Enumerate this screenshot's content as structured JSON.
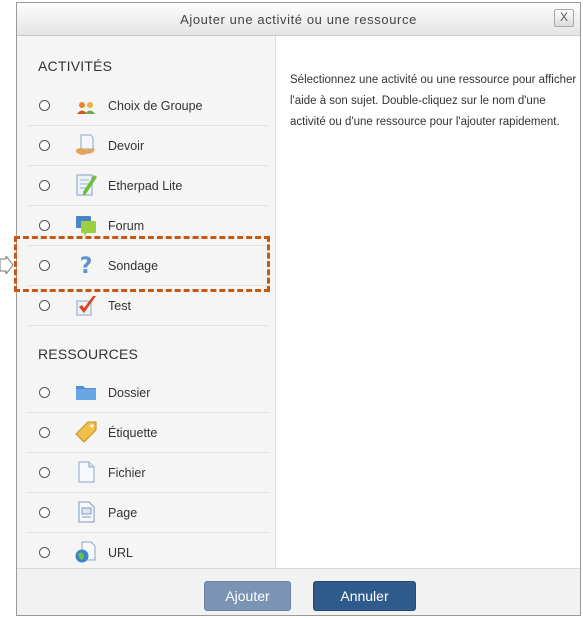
{
  "dialog": {
    "title": "Ajouter une activité ou une ressource",
    "close_label": "X"
  },
  "sections": {
    "activities": "ACTIVITÉS",
    "resources": "RESSOURCES"
  },
  "activities": [
    {
      "label": "Choix de Groupe",
      "icon": "group-choice-icon"
    },
    {
      "label": "Devoir",
      "icon": "assignment-icon"
    },
    {
      "label": "Etherpad Lite",
      "icon": "etherpad-icon"
    },
    {
      "label": "Forum",
      "icon": "forum-icon"
    },
    {
      "label": "Sondage",
      "icon": "question-icon"
    },
    {
      "label": "Test",
      "icon": "checkmark-icon"
    }
  ],
  "resources": [
    {
      "label": "Dossier",
      "icon": "folder-icon"
    },
    {
      "label": "Étiquette",
      "icon": "tag-icon"
    },
    {
      "label": "Fichier",
      "icon": "file-icon"
    },
    {
      "label": "Page",
      "icon": "page-icon"
    },
    {
      "label": "URL",
      "icon": "globe-link-icon"
    }
  ],
  "help_text": "Sélectionnez une activité ou une ressource pour afficher l'aide à son sujet. Double-cliquez sur le nom d'une activité ou d'une ressource pour l'ajouter rapidement.",
  "buttons": {
    "add": "Ajouter",
    "cancel": "Annuler"
  },
  "colors": {
    "highlight": "#c65911",
    "add_button": "#7b94b4",
    "cancel_button": "#2f5a8c"
  }
}
